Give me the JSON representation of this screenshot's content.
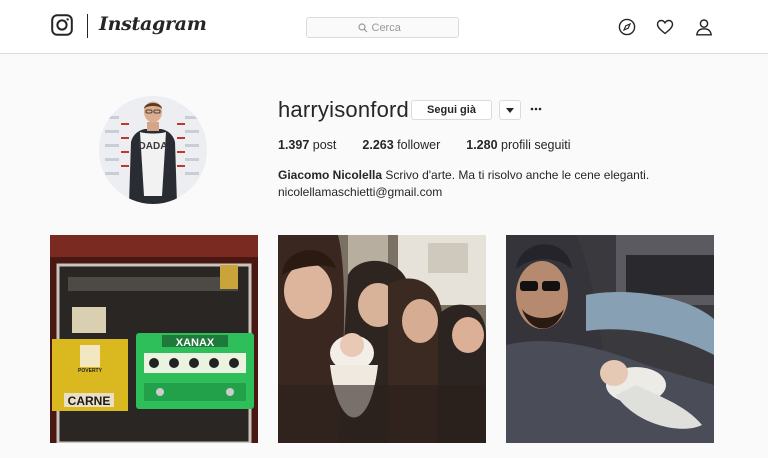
{
  "app": {
    "name": "Instagram"
  },
  "header": {
    "wordmark": "Instagram",
    "search_placeholder": "Cerca",
    "nav_icons": [
      "compass-icon",
      "heart-icon",
      "user-icon"
    ]
  },
  "profile": {
    "username": "harryisonford",
    "follow_label": "Segui già",
    "stats": {
      "posts_count": "1.397",
      "posts_label": "post",
      "followers_count": "2.263",
      "followers_label": "follower",
      "following_count": "1.280",
      "following_label": "profili seguiti"
    },
    "full_name": "Giacomo Nicolella",
    "bio": "Scrivo d'arte. Ma ti risolvo anche le cene eleganti.",
    "email": "nicolellamaschietti@gmail.com",
    "avatar_shirt_text": "DADA"
  },
  "posts": [
    {
      "id": "post-guitar-pedals",
      "texts": {
        "pedal_brand": "XANAX",
        "sticker": "CARNE",
        "poster": "POVERTY"
      }
    },
    {
      "id": "post-family-baby"
    },
    {
      "id": "post-man-baby"
    }
  ],
  "colors": {
    "accent": "#262626",
    "border": "#dbdbdb",
    "background": "#fafafa",
    "pedal_green": "#2fbf5a",
    "pedal_yellow": "#d9b820"
  }
}
